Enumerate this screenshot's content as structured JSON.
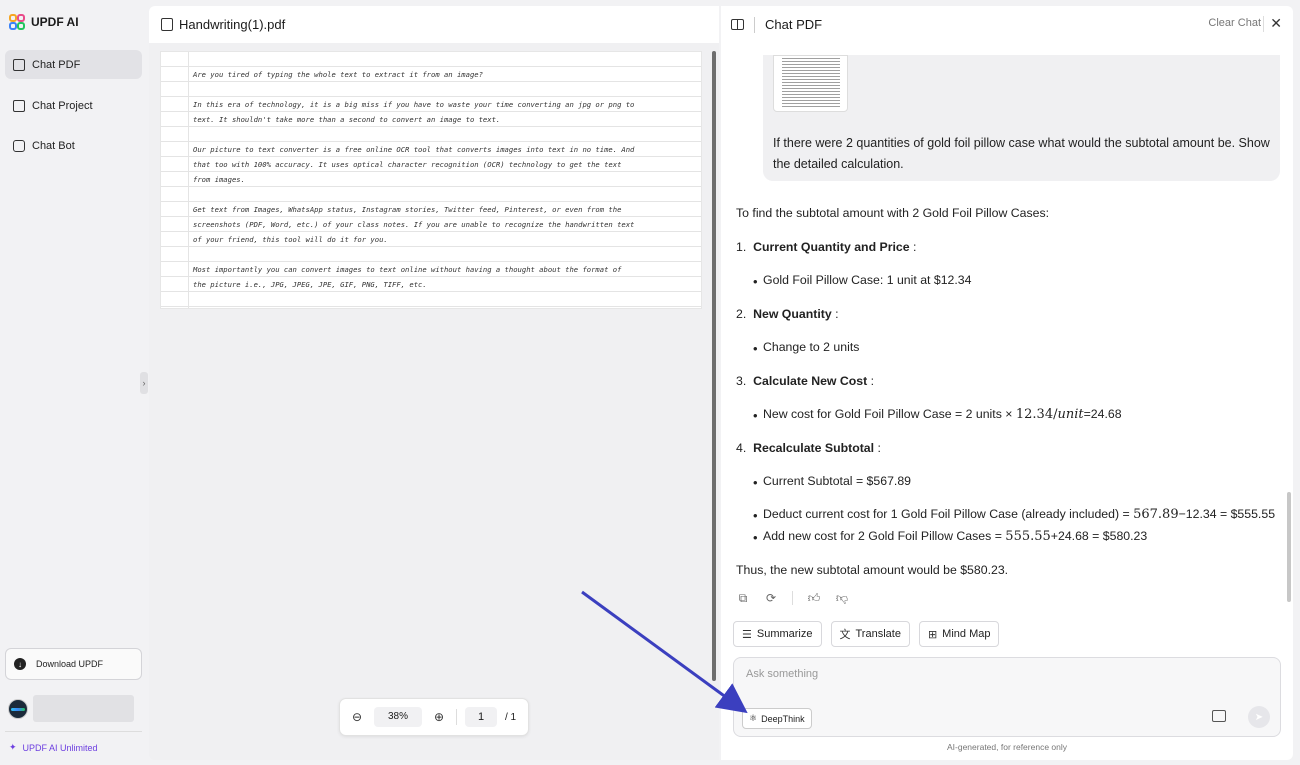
{
  "app": {
    "name": "UPDF AI"
  },
  "sidebar": {
    "items": [
      {
        "label": "Chat PDF",
        "active": true
      },
      {
        "label": "Chat Project",
        "active": false
      },
      {
        "label": "Chat Bot",
        "active": false
      }
    ],
    "download_label": "Download UPDF",
    "unlimited_label": "UPDF AI Unlimited"
  },
  "pdf": {
    "filename": "Handwriting(1).pdf",
    "lines": [
      "Are you tired of typing the whole text to extract it from an image?",
      "In this era of technology, it is a big miss if you have to waste your time converting an jpg or png to",
      "text. It shouldn't take more than a second to convert an image to text.",
      "Our picture to text converter is a free online OCR tool that converts images into text in no time. And",
      "that too with 100% accuracy. It uses optical character recognition (OCR) technology to get the text",
      "from images.",
      "Get text from Images, WhatsApp status, Instagram stories, Twitter feed, Pinterest, or even from the",
      "screenshots (PDF, Word, etc.) of your class notes. If you are unable to recognize the handwritten text",
      "of your friend, this tool will do it for you.",
      "Most importantly you can convert images to text online without having a thought about the format of",
      "the picture i.e., JPG, JPEG, JPE, GIF, PNG, TIFF, etc."
    ],
    "zoom": "38%",
    "page_current": "1",
    "page_total": "/ 1"
  },
  "chat": {
    "title": "Chat PDF",
    "clear_label": "Clear Chat",
    "user_message": "If there were 2 quantities of gold foil pillow case what would the subtotal amount be. Show the detailed calculation.",
    "answer": {
      "intro": "To find the subtotal amount with 2 Gold Foil Pillow Cases:",
      "s1_num": "1.",
      "s1_title": "Current Quantity and Price",
      "s1_colon": " :",
      "s1_b1": "Gold Foil Pillow Case: 1 unit at $12.34",
      "s2_num": "2.",
      "s2_title": "New Quantity",
      "s2_colon": " :",
      "s2_b1": "Change to 2 units",
      "s3_num": "3.",
      "s3_title": "Calculate New Cost",
      "s3_colon": " :",
      "s3_b1_pre": "New cost for Gold Foil Pillow Case = 2 units × ",
      "s3_b1_math": "12.34/",
      "s3_b1_unit": "unit",
      "s3_b1_post": "=24.68",
      "s4_num": "4.",
      "s4_title": "Recalculate Subtotal",
      "s4_colon": " :",
      "s4_b1": "Current Subtotal = $567.89",
      "s4_b2_pre": "Deduct current cost for 1 Gold Foil Pillow Case (already included) = ",
      "s4_b2_math": "567.89",
      "s4_b2_post": "−12.34 = $555.55",
      "s4_b3_pre": "Add new cost for 2 Gold Foil Pillow Cases = ",
      "s4_b3_math": "555.55",
      "s4_b3_post": "+24.68 = $580.23",
      "conclusion": "Thus, the new subtotal amount would be $580.23."
    },
    "quick_actions": [
      "Summarize",
      "Translate",
      "Mind Map"
    ],
    "input_placeholder": "Ask something",
    "deepthink_label": "DeepThink",
    "note": "AI-generated, for reference only"
  },
  "colors": {
    "accent": "#6d3fe0",
    "arrow": "#3b3fbf"
  }
}
